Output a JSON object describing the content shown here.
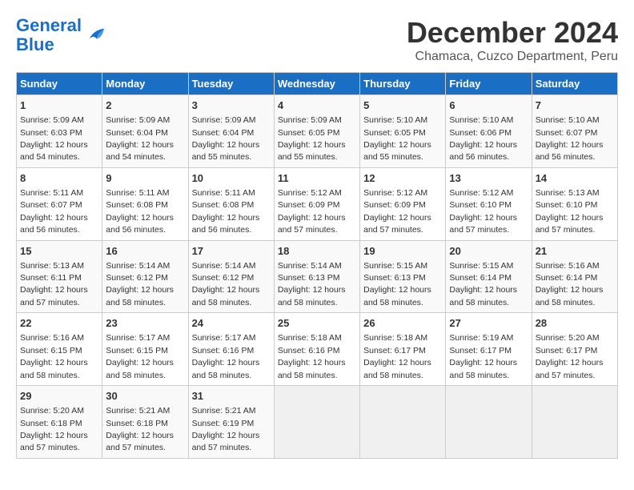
{
  "logo": {
    "line1": "General",
    "line2": "Blue"
  },
  "title": "December 2024",
  "subtitle": "Chamaca, Cuzco Department, Peru",
  "weekdays": [
    "Sunday",
    "Monday",
    "Tuesday",
    "Wednesday",
    "Thursday",
    "Friday",
    "Saturday"
  ],
  "weeks": [
    [
      {
        "day": "1",
        "info": "Sunrise: 5:09 AM\nSunset: 6:03 PM\nDaylight: 12 hours and 54 minutes."
      },
      {
        "day": "2",
        "info": "Sunrise: 5:09 AM\nSunset: 6:04 PM\nDaylight: 12 hours and 54 minutes."
      },
      {
        "day": "3",
        "info": "Sunrise: 5:09 AM\nSunset: 6:04 PM\nDaylight: 12 hours and 55 minutes."
      },
      {
        "day": "4",
        "info": "Sunrise: 5:09 AM\nSunset: 6:05 PM\nDaylight: 12 hours and 55 minutes."
      },
      {
        "day": "5",
        "info": "Sunrise: 5:10 AM\nSunset: 6:05 PM\nDaylight: 12 hours and 55 minutes."
      },
      {
        "day": "6",
        "info": "Sunrise: 5:10 AM\nSunset: 6:06 PM\nDaylight: 12 hours and 56 minutes."
      },
      {
        "day": "7",
        "info": "Sunrise: 5:10 AM\nSunset: 6:07 PM\nDaylight: 12 hours and 56 minutes."
      }
    ],
    [
      {
        "day": "8",
        "info": "Sunrise: 5:11 AM\nSunset: 6:07 PM\nDaylight: 12 hours and 56 minutes."
      },
      {
        "day": "9",
        "info": "Sunrise: 5:11 AM\nSunset: 6:08 PM\nDaylight: 12 hours and 56 minutes."
      },
      {
        "day": "10",
        "info": "Sunrise: 5:11 AM\nSunset: 6:08 PM\nDaylight: 12 hours and 56 minutes."
      },
      {
        "day": "11",
        "info": "Sunrise: 5:12 AM\nSunset: 6:09 PM\nDaylight: 12 hours and 57 minutes."
      },
      {
        "day": "12",
        "info": "Sunrise: 5:12 AM\nSunset: 6:09 PM\nDaylight: 12 hours and 57 minutes."
      },
      {
        "day": "13",
        "info": "Sunrise: 5:12 AM\nSunset: 6:10 PM\nDaylight: 12 hours and 57 minutes."
      },
      {
        "day": "14",
        "info": "Sunrise: 5:13 AM\nSunset: 6:10 PM\nDaylight: 12 hours and 57 minutes."
      }
    ],
    [
      {
        "day": "15",
        "info": "Sunrise: 5:13 AM\nSunset: 6:11 PM\nDaylight: 12 hours and 57 minutes."
      },
      {
        "day": "16",
        "info": "Sunrise: 5:14 AM\nSunset: 6:12 PM\nDaylight: 12 hours and 58 minutes."
      },
      {
        "day": "17",
        "info": "Sunrise: 5:14 AM\nSunset: 6:12 PM\nDaylight: 12 hours and 58 minutes."
      },
      {
        "day": "18",
        "info": "Sunrise: 5:14 AM\nSunset: 6:13 PM\nDaylight: 12 hours and 58 minutes."
      },
      {
        "day": "19",
        "info": "Sunrise: 5:15 AM\nSunset: 6:13 PM\nDaylight: 12 hours and 58 minutes."
      },
      {
        "day": "20",
        "info": "Sunrise: 5:15 AM\nSunset: 6:14 PM\nDaylight: 12 hours and 58 minutes."
      },
      {
        "day": "21",
        "info": "Sunrise: 5:16 AM\nSunset: 6:14 PM\nDaylight: 12 hours and 58 minutes."
      }
    ],
    [
      {
        "day": "22",
        "info": "Sunrise: 5:16 AM\nSunset: 6:15 PM\nDaylight: 12 hours and 58 minutes."
      },
      {
        "day": "23",
        "info": "Sunrise: 5:17 AM\nSunset: 6:15 PM\nDaylight: 12 hours and 58 minutes."
      },
      {
        "day": "24",
        "info": "Sunrise: 5:17 AM\nSunset: 6:16 PM\nDaylight: 12 hours and 58 minutes."
      },
      {
        "day": "25",
        "info": "Sunrise: 5:18 AM\nSunset: 6:16 PM\nDaylight: 12 hours and 58 minutes."
      },
      {
        "day": "26",
        "info": "Sunrise: 5:18 AM\nSunset: 6:17 PM\nDaylight: 12 hours and 58 minutes."
      },
      {
        "day": "27",
        "info": "Sunrise: 5:19 AM\nSunset: 6:17 PM\nDaylight: 12 hours and 58 minutes."
      },
      {
        "day": "28",
        "info": "Sunrise: 5:20 AM\nSunset: 6:17 PM\nDaylight: 12 hours and 57 minutes."
      }
    ],
    [
      {
        "day": "29",
        "info": "Sunrise: 5:20 AM\nSunset: 6:18 PM\nDaylight: 12 hours and 57 minutes."
      },
      {
        "day": "30",
        "info": "Sunrise: 5:21 AM\nSunset: 6:18 PM\nDaylight: 12 hours and 57 minutes."
      },
      {
        "day": "31",
        "info": "Sunrise: 5:21 AM\nSunset: 6:19 PM\nDaylight: 12 hours and 57 minutes."
      },
      null,
      null,
      null,
      null
    ]
  ]
}
